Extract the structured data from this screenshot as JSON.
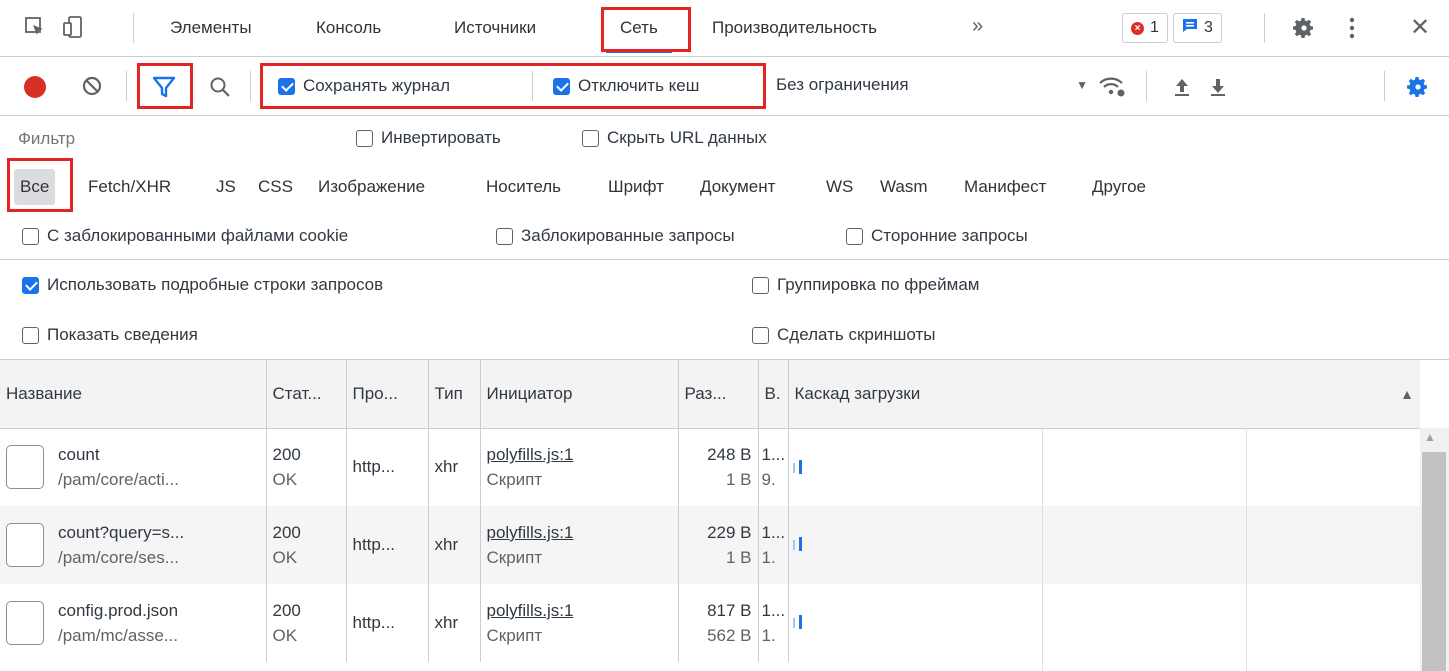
{
  "tabbar": {
    "tabs": [
      "Элементы",
      "Консоль",
      "Источники",
      "Сеть",
      "Производительность"
    ],
    "active_tab": "Сеть",
    "more": "»",
    "errors_count": "1",
    "messages_count": "3",
    "close": "✕"
  },
  "toolbar": {
    "preserve_log": "Сохранять журнал",
    "disable_cache": "Отключить кеш",
    "throttling": "Без ограничения"
  },
  "filter": {
    "placeholder": "Фильтр",
    "invert": "Инвертировать",
    "hide_data_urls": "Скрыть URL данных"
  },
  "types": [
    "Все",
    "Fetch/XHR",
    "JS",
    "CSS",
    "Изображение",
    "Носитель",
    "Шрифт",
    "Документ",
    "WS",
    "Wasm",
    "Манифест",
    "Другое"
  ],
  "blocked": {
    "blocked_cookies": "С заблокированными файлами cookie",
    "blocked_requests": "Заблокированные запросы",
    "third_party": "Сторонние запросы"
  },
  "settings": {
    "big_rows": "Использовать подробные строки запросов",
    "group_frames": "Группировка по фреймам",
    "overview": "Показать сведения",
    "screenshots": "Сделать скриншоты"
  },
  "table": {
    "columns": [
      "Название",
      "Стат...",
      "Про...",
      "Тип",
      "Инициатор",
      "Раз...",
      "В.",
      "Каскад загрузки"
    ],
    "sort_indicator": "▲",
    "rows": [
      {
        "name": "count",
        "path": "/pam/core/acti...",
        "status": "200",
        "status_text": "OK",
        "protocol": "http...",
        "type": "xhr",
        "initiator": "polyfills.js:1",
        "initiator_type": "Скрипт",
        "size": "248 B",
        "size2": "1 B",
        "time": "1...",
        "time2": "9."
      },
      {
        "name": "count?query=s...",
        "path": "/pam/core/ses...",
        "status": "200",
        "status_text": "OK",
        "protocol": "http...",
        "type": "xhr",
        "initiator": "polyfills.js:1",
        "initiator_type": "Скрипт",
        "size": "229 B",
        "size2": "1 B",
        "time": "1...",
        "time2": "1."
      },
      {
        "name": "config.prod.json",
        "path": "/pam/mc/asse...",
        "status": "200",
        "status_text": "OK",
        "protocol": "http...",
        "type": "xhr",
        "initiator": "polyfills.js:1",
        "initiator_type": "Скрипт",
        "size": "817 B",
        "size2": "562 B",
        "time": "1...",
        "time2": "1."
      }
    ]
  },
  "colors": {
    "accent": "#1a73e8",
    "record": "#d93025",
    "highlight_box": "#e32424"
  }
}
